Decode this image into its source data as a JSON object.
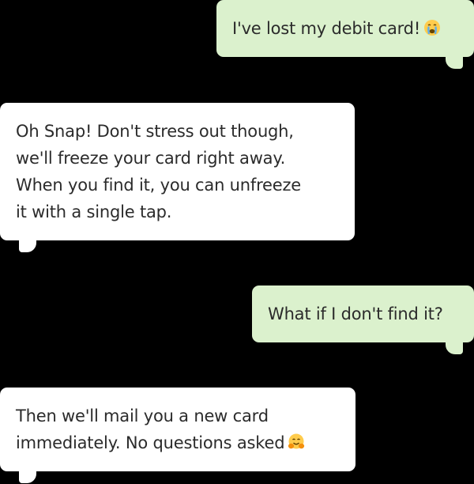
{
  "conversation": {
    "messages": [
      {
        "sender": "user",
        "lines": [
          "I've lost my debit card!"
        ],
        "emoji": "crying-face-icon"
      },
      {
        "sender": "bot",
        "lines": [
          "Oh Snap! Don't stress out though,",
          "we'll freeze your card right away.",
          "When you find it, you can unfreeze",
          "it with a single tap."
        ]
      },
      {
        "sender": "user",
        "lines": [
          "What if I don't find it?"
        ]
      },
      {
        "sender": "bot",
        "lines": [
          "Then we'll mail you a new card",
          "immediately. No questions asked"
        ],
        "emoji": "hugging-face-icon"
      }
    ]
  },
  "colors": {
    "background": "#000000",
    "sent_bubble": "#dbf1cd",
    "received_bubble": "#ffffff",
    "text": "#2b2b2b"
  }
}
